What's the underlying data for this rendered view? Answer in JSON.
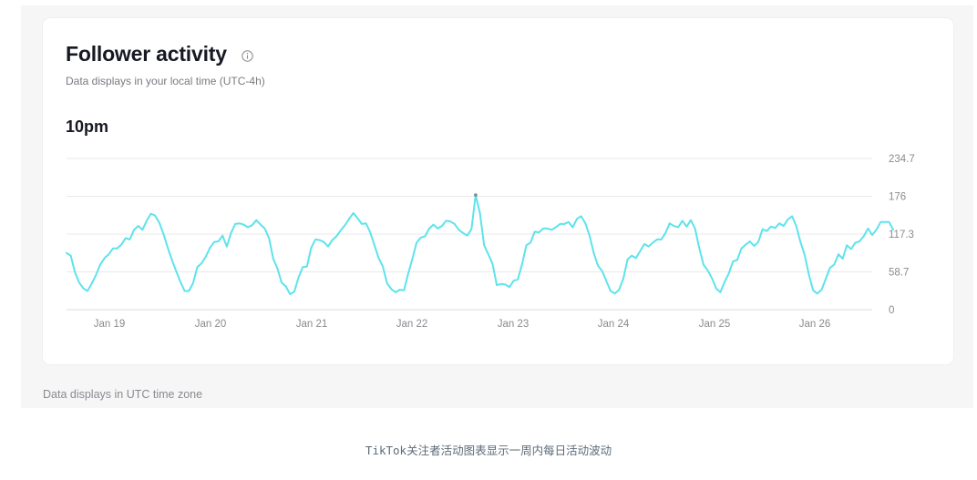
{
  "card": {
    "title": "Follower activity",
    "subtitle": "Data displays in your local time (UTC-4h)",
    "peak_time": "10pm"
  },
  "footer_note": "Data displays in UTC time zone",
  "caption": "TikTok关注者活动图表显示一周内每日活动波动",
  "colors": {
    "line": "#5ee3eb",
    "grid": "#e8e8ea",
    "card_bg": "#ffffff",
    "panel_bg": "#f6f6f7"
  },
  "chart_data": {
    "type": "line",
    "x_tick_labels": [
      "Jan 19",
      "Jan 20",
      "Jan 21",
      "Jan 22",
      "Jan 23",
      "Jan 24",
      "Jan 25",
      "Jan 26"
    ],
    "y_tick_labels": [
      "234.7",
      "176",
      "117.3",
      "58.7",
      "0"
    ],
    "ylim": [
      0,
      234.7
    ],
    "xlim": [
      0,
      191
    ],
    "grid": true,
    "series": [
      {
        "values": [
          88,
          84,
          58,
          42,
          33,
          29,
          41,
          54,
          70,
          80,
          86,
          95,
          95,
          101,
          111,
          109,
          124,
          130,
          124,
          138,
          149,
          146,
          135,
          117,
          96,
          77,
          60,
          43,
          29,
          29,
          41,
          66,
          72,
          82,
          96,
          105,
          106,
          115,
          98,
          119,
          133,
          134,
          132,
          128,
          131,
          139,
          132,
          126,
          111,
          79,
          64,
          42,
          36,
          24,
          28,
          50,
          66,
          67,
          96,
          109,
          108,
          105,
          98,
          108,
          114,
          123,
          131,
          141,
          150,
          142,
          133,
          134,
          120,
          100,
          80,
          67,
          41,
          32,
          27,
          31,
          30,
          56,
          79,
          104,
          112,
          114,
          126,
          132,
          126,
          130,
          138,
          137,
          133,
          124,
          119,
          115,
          125,
          178,
          150,
          100,
          86,
          71,
          38,
          40,
          39,
          35,
          45,
          47,
          71,
          100,
          104,
          121,
          120,
          126,
          126,
          124,
          128,
          133,
          133,
          136,
          128,
          141,
          145,
          134,
          115,
          88,
          68,
          60,
          44,
          29,
          25,
          31,
          48,
          78,
          84,
          80,
          91,
          102,
          98,
          104,
          109,
          109,
          119,
          134,
          130,
          128,
          138,
          129,
          139,
          126,
          96,
          70,
          61,
          49,
          33,
          27,
          43,
          56,
          75,
          77,
          95,
          101,
          106,
          99,
          105,
          125,
          122,
          129,
          127,
          134,
          130,
          140,
          145,
          130,
          105,
          85,
          54,
          30,
          25,
          31,
          48,
          65,
          70,
          86,
          79,
          100,
          94,
          104,
          106,
          114,
          126,
          116,
          124,
          136,
          136,
          136,
          124
        ]
      }
    ]
  }
}
